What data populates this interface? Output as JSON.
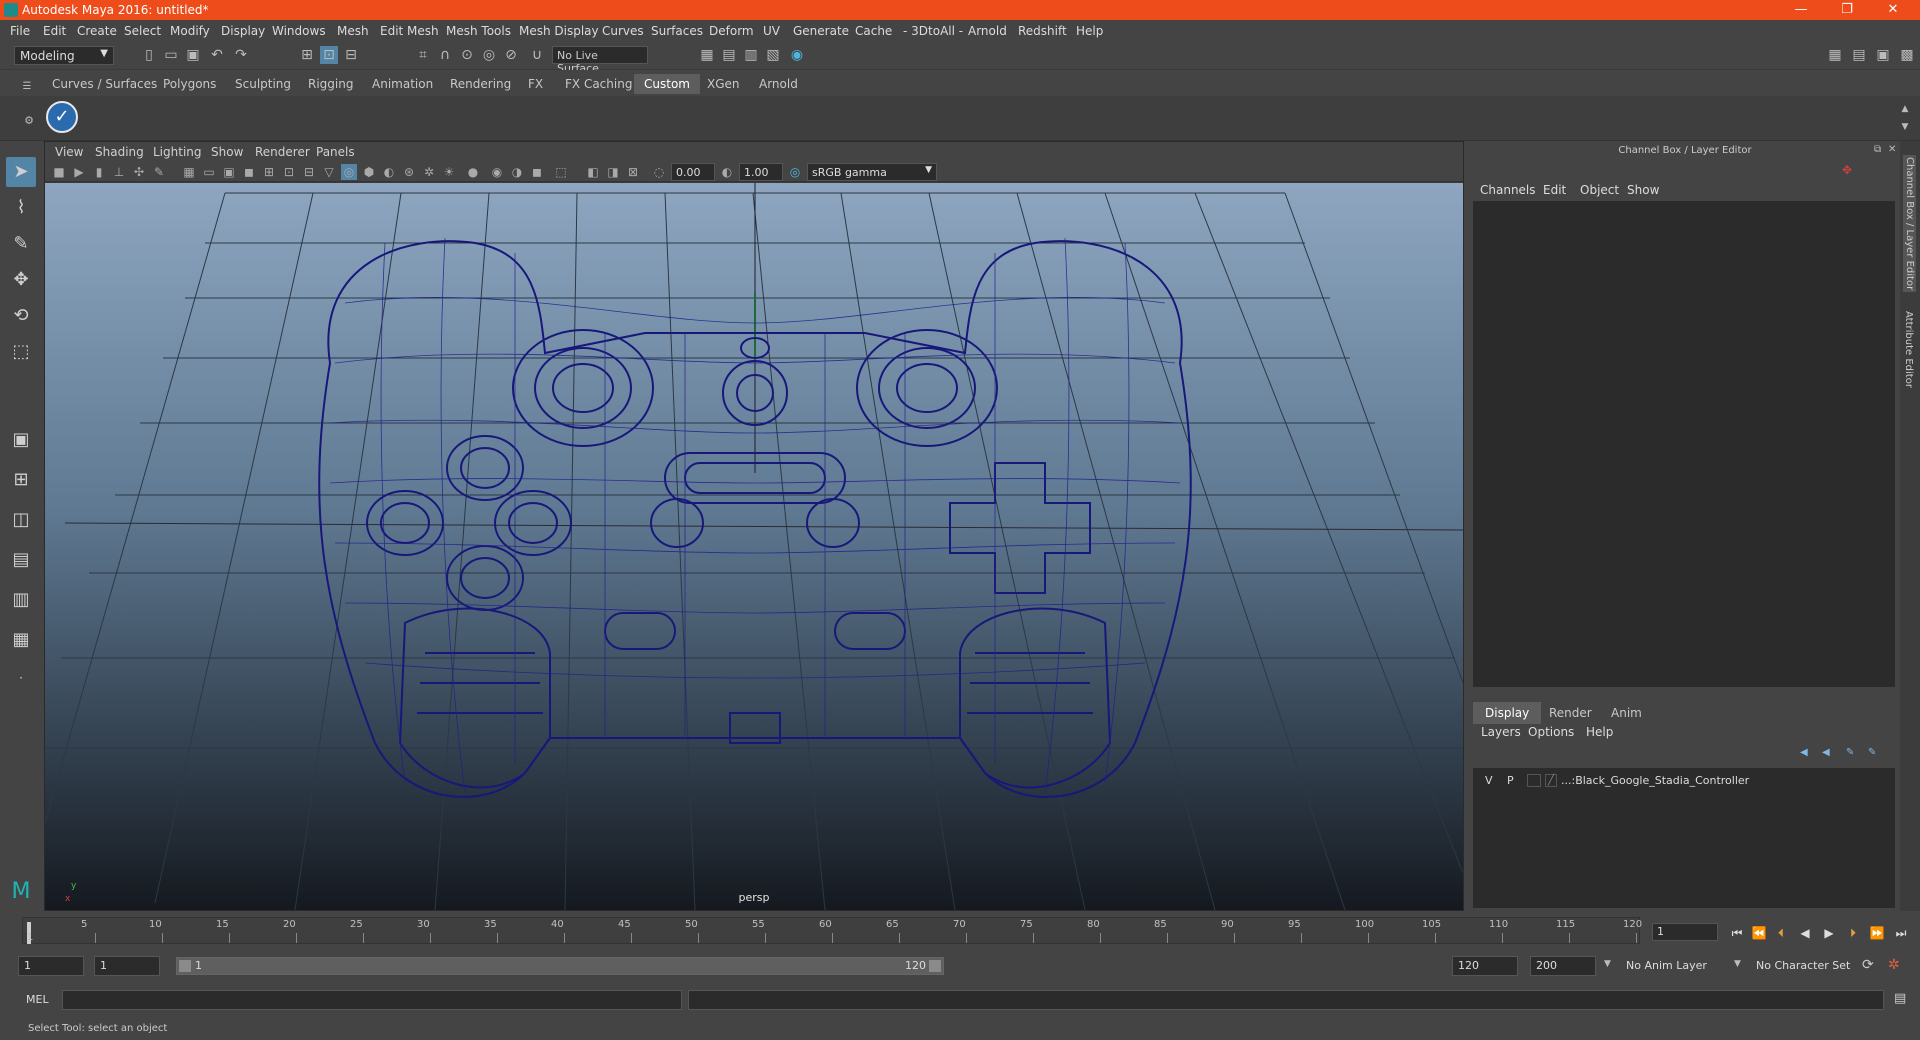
{
  "window": {
    "title": "Autodesk Maya 2016: untitled*",
    "min": "—",
    "max": "❐",
    "close": "✕"
  },
  "menu": [
    "File",
    "Edit",
    "Create",
    "Select",
    "Modify",
    "Display",
    "Windows",
    "Mesh",
    "Edit Mesh",
    "Mesh Tools",
    "Mesh Display",
    "Curves",
    "Surfaces",
    "Deform",
    "UV",
    "Generate",
    "Cache",
    "- 3DtoAll -",
    "Arnold",
    "Redshift",
    "Help"
  ],
  "statusline": {
    "mode": "Modeling",
    "live_surface": "No Live Surface"
  },
  "shelf": {
    "tabs": [
      "Curves / Surfaces",
      "Polygons",
      "Sculpting",
      "Rigging",
      "Animation",
      "Rendering",
      "FX",
      "FX Caching",
      "Custom",
      "XGen",
      "Arnold"
    ],
    "active_tab": "Custom"
  },
  "viewport": {
    "menu": [
      "View",
      "Shading",
      "Lighting",
      "Show",
      "Renderer",
      "Panels"
    ],
    "exposure": "0.00",
    "gamma": "1.00",
    "color_space": "sRGB gamma",
    "camera": "persp",
    "wire_color": "#1a1a7a"
  },
  "channel_box": {
    "title": "Channel Box / Layer Editor",
    "menu": [
      "Channels",
      "Edit",
      "Object",
      "Show"
    ]
  },
  "layer_editor": {
    "tabs": [
      "Display",
      "Render",
      "Anim"
    ],
    "active_tab": "Display",
    "menu": [
      "Layers",
      "Options",
      "Help"
    ],
    "layers": [
      {
        "v": "V",
        "p": "P",
        "name": "...:Black_Google_Stadia_Controller"
      }
    ]
  },
  "side_tabs": [
    "Channel Box / Layer Editor",
    "Attribute Editor"
  ],
  "timeline": {
    "ticks": [
      "1",
      "5",
      "10",
      "15",
      "20",
      "25",
      "30",
      "35",
      "40",
      "45",
      "50",
      "55",
      "60",
      "65",
      "70",
      "75",
      "80",
      "85",
      "90",
      "95",
      "100",
      "105",
      "110",
      "115",
      "120"
    ],
    "current_frame": "1"
  },
  "range": {
    "start": "1",
    "inner_start": "1",
    "bar_start": "1",
    "bar_end": "120",
    "end": "120",
    "max": "200",
    "anim_layer": "No Anim Layer",
    "char_set": "No Character Set"
  },
  "cmd": {
    "label": "MEL"
  },
  "help": {
    "text": "Select Tool: select an object"
  }
}
